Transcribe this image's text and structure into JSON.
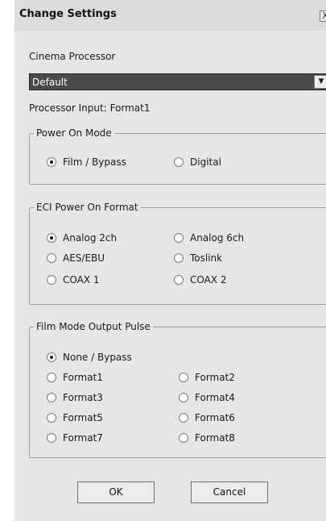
{
  "window": {
    "title": "Change Settings",
    "close_glyph": "X"
  },
  "cinema_processor": {
    "label": "Cinema Processor",
    "selected": "Default"
  },
  "processor_input": {
    "label": "Processor Input:",
    "value": "Format1"
  },
  "power_on_mode": {
    "legend": "Power On Mode",
    "options": [
      "Film / Bypass",
      "Digital"
    ],
    "selected": "Film / Bypass"
  },
  "eci_power_on_format": {
    "legend": "ECI Power On Format",
    "options": [
      "Analog 2ch",
      "Analog 6ch",
      "AES/EBU",
      "Toslink",
      "COAX 1",
      "COAX 2"
    ],
    "selected": "Analog 2ch"
  },
  "film_mode_output_pulse": {
    "legend": "Film Mode Output Pulse",
    "options": [
      "None / Bypass",
      "Format1",
      "Format2",
      "Format3",
      "Format4",
      "Format5",
      "Format6",
      "Format7",
      "Format8"
    ],
    "selected": "None / Bypass"
  },
  "buttons": {
    "ok": "OK",
    "cancel": "Cancel"
  },
  "icons": {
    "close": "close-icon",
    "dropdown": "chevron-down-icon"
  }
}
